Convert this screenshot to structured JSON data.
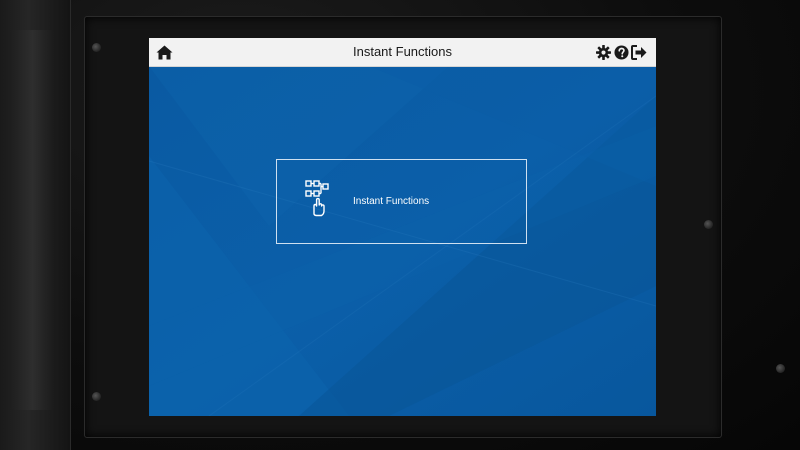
{
  "header": {
    "title": "Instant Functions",
    "home_icon": "home-icon",
    "settings_icon": "gear-icon",
    "help_icon": "help-icon",
    "logout_icon": "logout-icon"
  },
  "main": {
    "tiles": [
      {
        "label": "Instant Functions",
        "icon": "workflow-touch-icon"
      }
    ]
  },
  "colors": {
    "screen_background": "#0a5ba3",
    "header_background": "#f2f2f2",
    "header_text": "#1a1a1a",
    "tile_text": "#ffffff",
    "tile_border": "#cfe0f0"
  }
}
